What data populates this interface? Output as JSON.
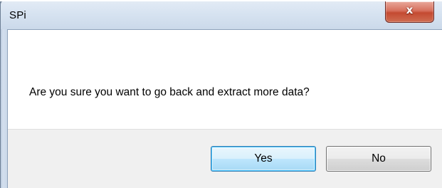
{
  "window": {
    "title": "SPi",
    "close_glyph": "x",
    "close_icon": "close-icon"
  },
  "dialog": {
    "message": "Are you sure you want to go back and extract more data?",
    "buttons": {
      "yes_label": "Yes",
      "no_label": "No"
    }
  },
  "colors": {
    "close_button": "#c44a31",
    "default_button_border": "#3c7fb1",
    "footer_background": "#f0f0f0"
  }
}
